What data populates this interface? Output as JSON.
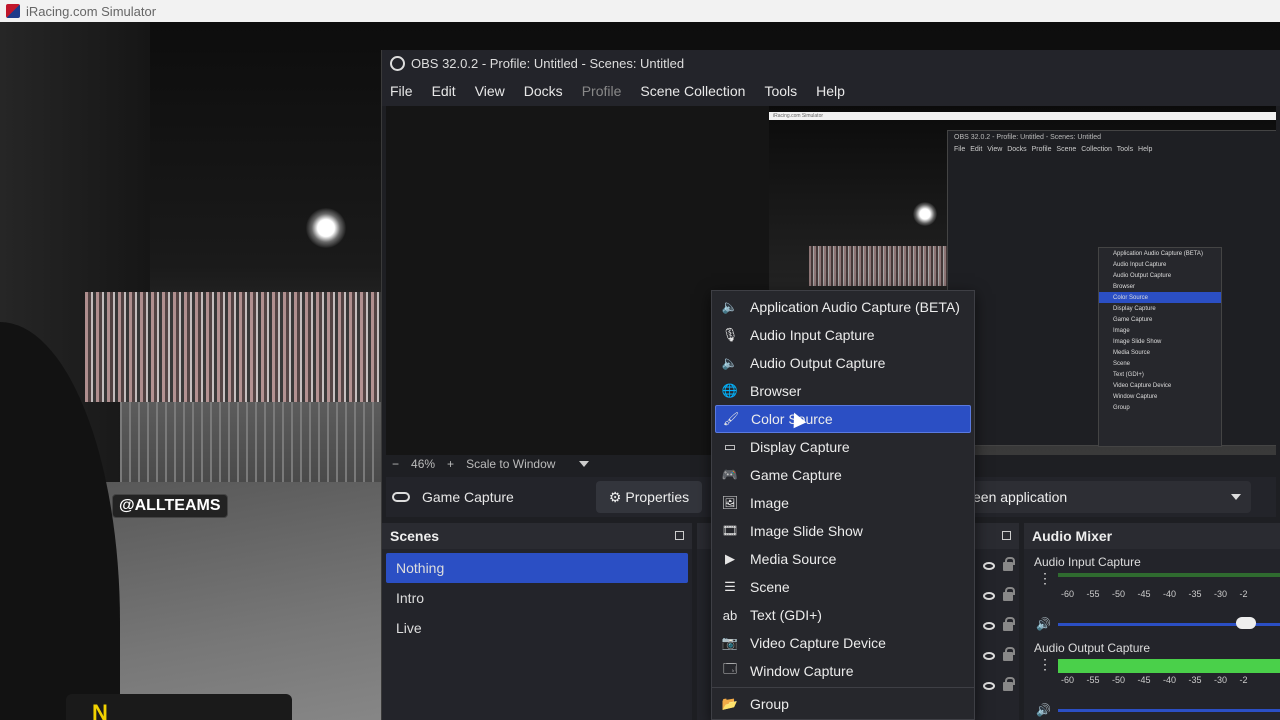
{
  "host": {
    "title": "iRacing.com Simulator"
  },
  "overlay": {
    "tag": "@ALLTEAMS",
    "hud_letter": "N"
  },
  "obs": {
    "title": "OBS 32.0.2 - Profile: Untitled - Scenes: Untitled",
    "menu": [
      "File",
      "Edit",
      "View",
      "Docks",
      "Profile",
      "Scene Collection",
      "Tools",
      "Help"
    ],
    "zoom": {
      "minus": "−",
      "percent": "46%",
      "plus": "+",
      "mode": "Scale to Window"
    },
    "sourcebar": {
      "source": "Game Capture",
      "properties": "Properties",
      "window": "een application"
    },
    "scenes": {
      "title": "Scenes",
      "items": [
        "Nothing",
        "Intro",
        "Live"
      ]
    },
    "mixer": {
      "title": "Audio Mixer",
      "channels": [
        {
          "name": "Audio Input Capture",
          "scale": "-60 -55 -50 -45 -40 -35 -30 -2"
        },
        {
          "name": "Audio Output Capture",
          "scale": "-60 -55 -50 -45 -40 -35 -30 -2"
        }
      ]
    },
    "nested_preview": {
      "title": "OBS 32.0.2 - Profile: Untitled - Scenes: Untitled",
      "menu": "File Edit View Docks Profile Scene Collection Tools Help",
      "strip": "iRacing.com Simulator",
      "menu_items": [
        "Application Audio Capture (BETA)",
        "Audio Input Capture",
        "Audio Output Capture",
        "Browser",
        "Color Source",
        "Display Capture",
        "Game Capture",
        "Image",
        "Image Slide Show",
        "Media Source",
        "Scene",
        "Text (GDI+)",
        "Video Capture Device",
        "Window Capture",
        "Group"
      ]
    }
  },
  "context_menu": {
    "items": [
      {
        "label": "Application Audio Capture (BETA)",
        "icon": "speaker-icon"
      },
      {
        "label": "Audio Input Capture",
        "icon": "microphone-icon"
      },
      {
        "label": "Audio Output Capture",
        "icon": "speaker-icon"
      },
      {
        "label": "Browser",
        "icon": "globe-icon"
      },
      {
        "label": "Color Source",
        "icon": "brush-icon",
        "highlighted": true
      },
      {
        "label": "Display Capture",
        "icon": "monitor-icon"
      },
      {
        "label": "Game Capture",
        "icon": "gamepad-icon"
      },
      {
        "label": "Image",
        "icon": "image-icon"
      },
      {
        "label": "Image Slide Show",
        "icon": "slideshow-icon"
      },
      {
        "label": "Media Source",
        "icon": "play-icon"
      },
      {
        "label": "Scene",
        "icon": "list-icon"
      },
      {
        "label": "Text (GDI+)",
        "icon": "text-icon"
      },
      {
        "label": "Video Capture Device",
        "icon": "camera-icon"
      },
      {
        "label": "Window Capture",
        "icon": "window-icon"
      }
    ],
    "group": {
      "label": "Group",
      "icon": "folder-icon"
    }
  },
  "colors": {
    "accent": "#2b4fc4",
    "panel": "#23242a",
    "meter_green": "#4ad04a"
  }
}
